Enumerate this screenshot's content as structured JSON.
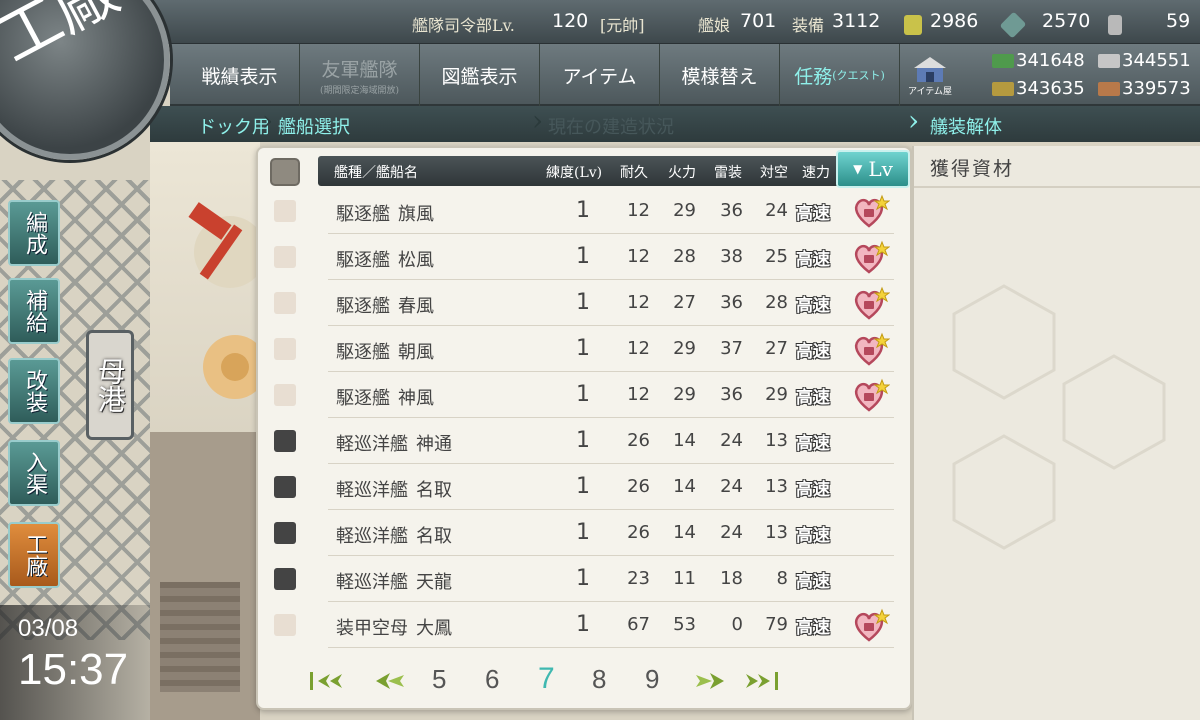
{
  "topbar": {
    "hq_label": "艦隊司令部Lv.",
    "hq_level": "120",
    "rank": "[元帥]",
    "ships_label": "艦娘",
    "ships_count": "701",
    "equip_label": "装備",
    "equip_count": "3112",
    "bucket_count": "2986",
    "devmat_count": "2570",
    "screw_count": "59"
  },
  "menu": {
    "items": [
      {
        "label": "戦績表示"
      },
      {
        "label": "友軍艦隊",
        "sub": "(期間限定海域開放)"
      },
      {
        "label": "図鑑表示"
      },
      {
        "label": "アイテム"
      },
      {
        "label": "模様替え"
      },
      {
        "label": "任務",
        "suffix": "(クエスト)"
      }
    ],
    "item_shop_label": "アイテム屋"
  },
  "resources": {
    "fuel": "341648",
    "steel": "344551",
    "ammo": "343635",
    "bauxite": "339573"
  },
  "breadcrumb": {
    "dock": "ドック用",
    "select": "艦船選択",
    "status": "現在の建造状況",
    "dismantle": "艤装解体"
  },
  "badge": {
    "title": "工廠"
  },
  "leftnav": {
    "items": [
      "編成",
      "補給",
      "改装",
      "入渠",
      "工廠"
    ],
    "port": "母港"
  },
  "clock": {
    "date": "03/08",
    "time": "15:37"
  },
  "table": {
    "headers": {
      "name": "艦種／艦船名",
      "level": "練度(Lv)",
      "hp": "耐久",
      "fire": "火力",
      "torpedo": "雷装",
      "aa": "対空",
      "speed": "速力",
      "sort": "Lv"
    },
    "rows": [
      {
        "type": "駆逐艦",
        "name": "旗風",
        "lv": "1",
        "hp": "12",
        "fire": "29",
        "torp": "36",
        "aa": "24",
        "speed": "高速",
        "locked": true,
        "checked": false
      },
      {
        "type": "駆逐艦",
        "name": "松風",
        "lv": "1",
        "hp": "12",
        "fire": "28",
        "torp": "38",
        "aa": "25",
        "speed": "高速",
        "locked": true,
        "checked": false
      },
      {
        "type": "駆逐艦",
        "name": "春風",
        "lv": "1",
        "hp": "12",
        "fire": "27",
        "torp": "36",
        "aa": "28",
        "speed": "高速",
        "locked": true,
        "checked": false
      },
      {
        "type": "駆逐艦",
        "name": "朝風",
        "lv": "1",
        "hp": "12",
        "fire": "29",
        "torp": "37",
        "aa": "27",
        "speed": "高速",
        "locked": true,
        "checked": false
      },
      {
        "type": "駆逐艦",
        "name": "神風",
        "lv": "1",
        "hp": "12",
        "fire": "29",
        "torp": "36",
        "aa": "29",
        "speed": "高速",
        "locked": true,
        "checked": false
      },
      {
        "type": "軽巡洋艦",
        "name": "神通",
        "lv": "1",
        "hp": "26",
        "fire": "14",
        "torp": "24",
        "aa": "13",
        "speed": "高速",
        "locked": false,
        "checked": true
      },
      {
        "type": "軽巡洋艦",
        "name": "名取",
        "lv": "1",
        "hp": "26",
        "fire": "14",
        "torp": "24",
        "aa": "13",
        "speed": "高速",
        "locked": false,
        "checked": true
      },
      {
        "type": "軽巡洋艦",
        "name": "名取",
        "lv": "1",
        "hp": "26",
        "fire": "14",
        "torp": "24",
        "aa": "13",
        "speed": "高速",
        "locked": false,
        "checked": true
      },
      {
        "type": "軽巡洋艦",
        "name": "天龍",
        "lv": "1",
        "hp": "23",
        "fire": "11",
        "torp": "18",
        "aa": "8",
        "speed": "高速",
        "locked": false,
        "checked": true
      },
      {
        "type": "装甲空母",
        "name": "大鳳",
        "lv": "1",
        "hp": "67",
        "fire": "53",
        "torp": "0",
        "aa": "79",
        "speed": "高速",
        "locked": true,
        "checked": false
      }
    ]
  },
  "pager": {
    "pages": [
      "5",
      "6",
      "7",
      "8",
      "9"
    ],
    "current": "7"
  },
  "right_panel": {
    "title": "獲得資材"
  },
  "colors": {
    "accent": "#3fb8b0",
    "active_menu": "#8ff0ea",
    "breadcrumb_active": "#8ff0ea"
  }
}
